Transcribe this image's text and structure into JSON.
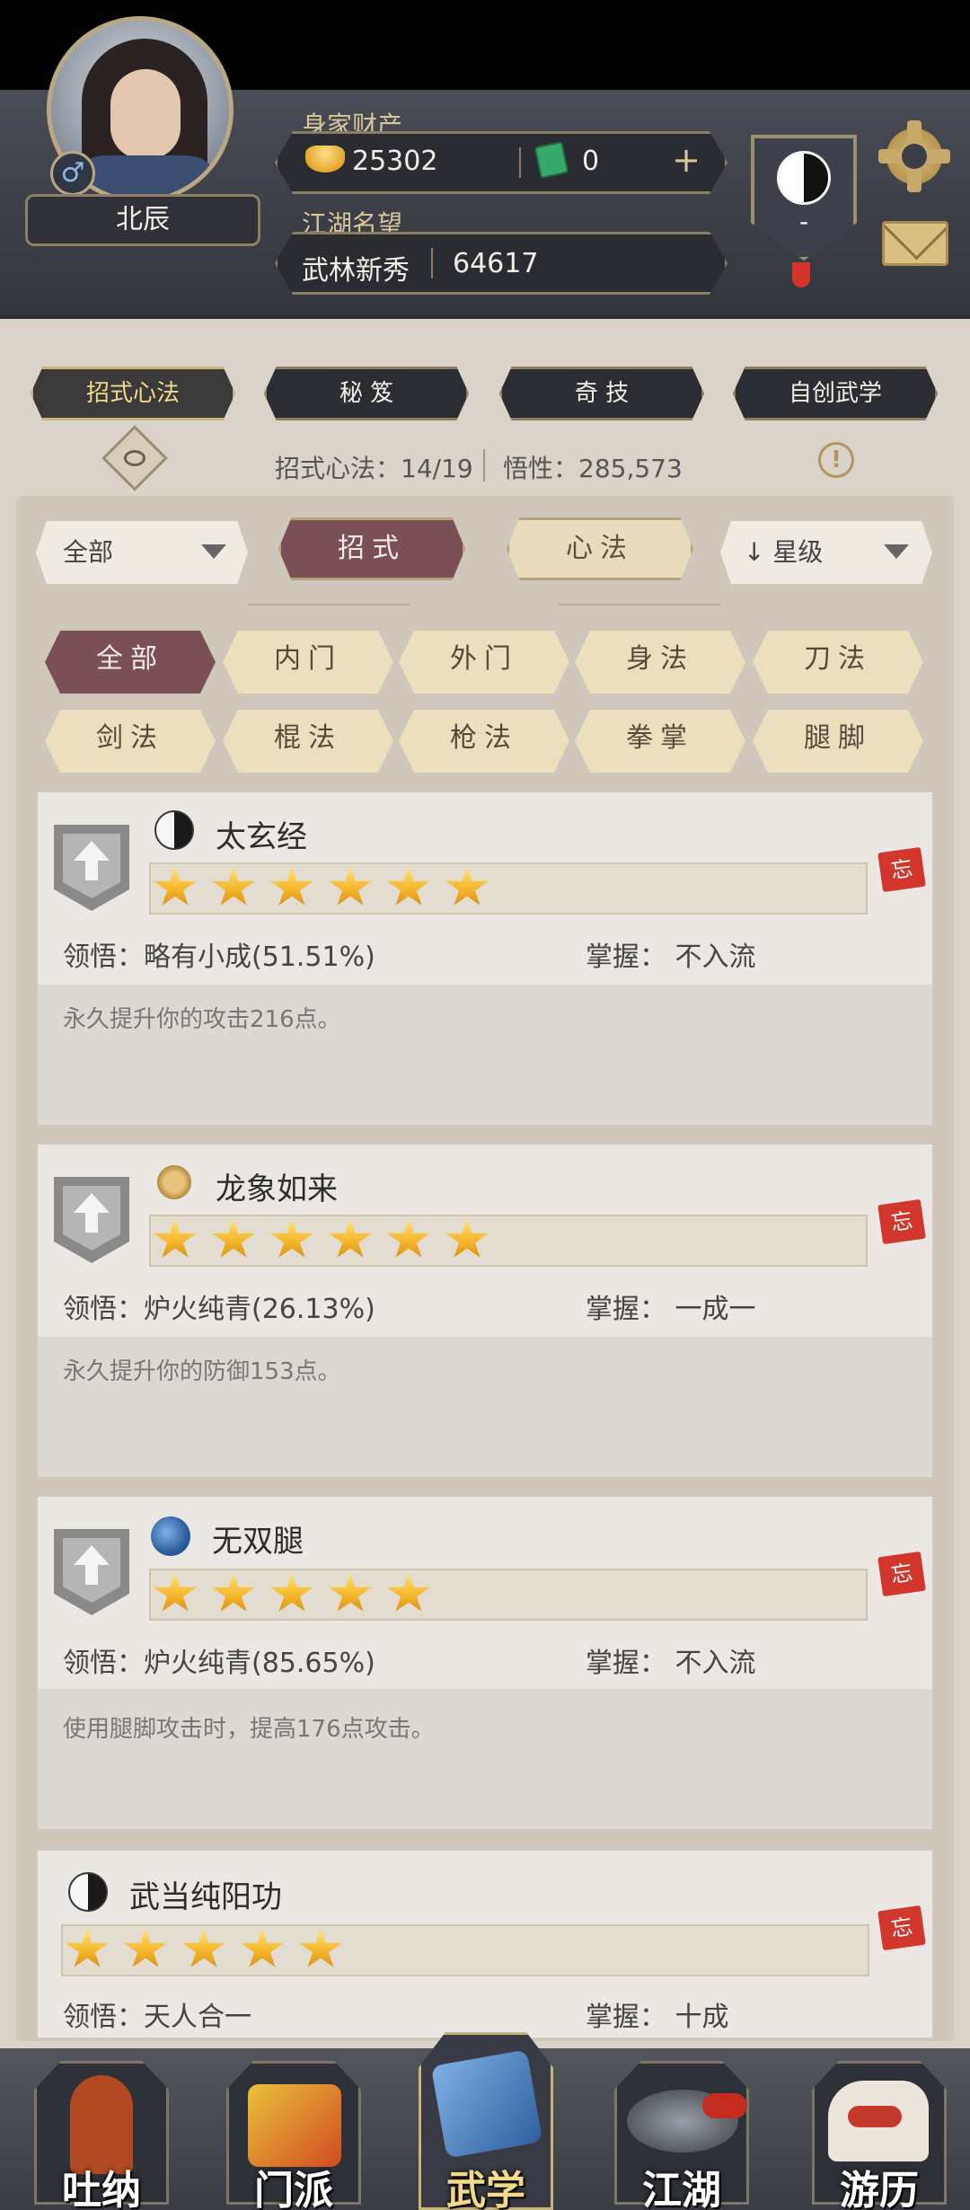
{
  "header": {
    "player_name": "北辰",
    "gender_symbol": "♂",
    "wealth_label": "身家财产",
    "gold_amount": "25302",
    "ticket_amount": "0",
    "add_symbol": "+",
    "fame_label": "江湖名望",
    "fame_title": "武林新秀",
    "fame_value": "64617",
    "banner_text": "-"
  },
  "top_tabs": [
    {
      "label": "招式心法",
      "active": true
    },
    {
      "label": "秘 笈",
      "active": false
    },
    {
      "label": "奇 技",
      "active": false
    },
    {
      "label": "自创武学",
      "active": false
    }
  ],
  "stats": {
    "skills": "招式心法：14/19",
    "insight": "悟性：285,573",
    "info_symbol": "!"
  },
  "controls": {
    "scope_select": "全部",
    "segment_moves": "招式",
    "segment_mind": "心法",
    "sort_select": "↓ 星级"
  },
  "filters": [
    "全部",
    "内门",
    "外门",
    "身法",
    "刀法",
    "剑法",
    "棍法",
    "枪法",
    "拳掌",
    "腿脚"
  ],
  "active_filter": "全部",
  "skills": [
    {
      "name": "太玄经",
      "stars": 6,
      "insight": "领悟：略有小成(51.51%)",
      "mastery": "掌握：  不入流",
      "desc": "永久提升你的攻击216点。",
      "forget": "忘",
      "icon": "taiji-icon"
    },
    {
      "name": "龙象如来",
      "stars": 6,
      "insight": "领悟：炉火纯青(26.13%)",
      "mastery": "掌握：  一成一",
      "desc": "永久提升你的防御153点。",
      "forget": "忘",
      "icon": "horn-icon"
    },
    {
      "name": "无双腿",
      "stars": 5,
      "insight": "领悟：炉火纯青(85.65%)",
      "mastery": "掌握：  不入流",
      "desc": "使用腿脚攻击时，提高176点攻击。",
      "forget": "忘",
      "icon": "wave-icon"
    },
    {
      "name": "武当纯阳功",
      "stars": 5,
      "insight": "领悟：天人合一",
      "mastery": "掌握：  十成",
      "desc": "",
      "forget": "忘",
      "icon": "taiji-icon"
    }
  ],
  "bottom_nav": [
    {
      "label": "吐纳",
      "active": false
    },
    {
      "label": "门派",
      "active": false
    },
    {
      "label": "武学",
      "active": true
    },
    {
      "label": "江湖",
      "active": false
    },
    {
      "label": "游历",
      "active": false
    }
  ]
}
